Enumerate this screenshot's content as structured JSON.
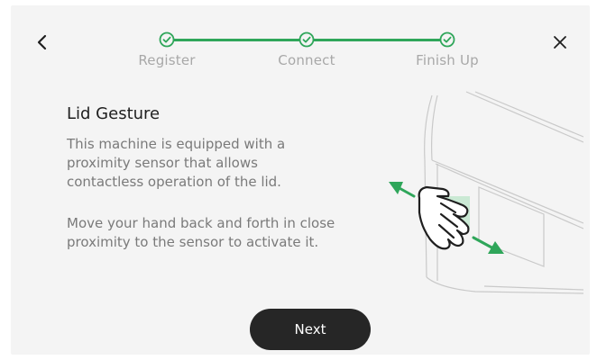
{
  "steps": [
    {
      "label": "Register"
    },
    {
      "label": "Connect"
    },
    {
      "label": "Finish Up"
    }
  ],
  "content": {
    "title": "Lid Gesture",
    "paragraph1": "This machine is equipped with a proximity sensor that allows contactless operation of the lid.",
    "paragraph2": "Move your hand back and forth in close proximity to the sensor to activate it."
  },
  "buttons": {
    "next_label": "Next"
  },
  "icons": {
    "back": "chevron-left-icon",
    "close": "close-icon",
    "step_done": "check-circle-icon"
  },
  "colors": {
    "accent": "#2fa65a",
    "button": "#262626",
    "background": "#f4f4f4"
  }
}
